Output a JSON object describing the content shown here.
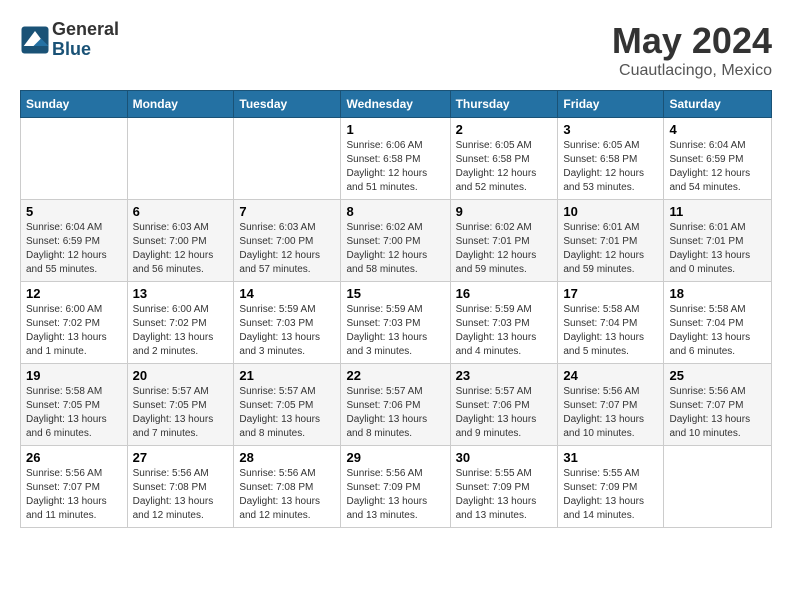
{
  "logo": {
    "general": "General",
    "blue": "Blue"
  },
  "title": "May 2024",
  "subtitle": "Cuautlacingo, Mexico",
  "days_of_week": [
    "Sunday",
    "Monday",
    "Tuesday",
    "Wednesday",
    "Thursday",
    "Friday",
    "Saturday"
  ],
  "weeks": [
    [
      {
        "day": "",
        "info": ""
      },
      {
        "day": "",
        "info": ""
      },
      {
        "day": "",
        "info": ""
      },
      {
        "day": "1",
        "info": "Sunrise: 6:06 AM\nSunset: 6:58 PM\nDaylight: 12 hours\nand 51 minutes."
      },
      {
        "day": "2",
        "info": "Sunrise: 6:05 AM\nSunset: 6:58 PM\nDaylight: 12 hours\nand 52 minutes."
      },
      {
        "day": "3",
        "info": "Sunrise: 6:05 AM\nSunset: 6:58 PM\nDaylight: 12 hours\nand 53 minutes."
      },
      {
        "day": "4",
        "info": "Sunrise: 6:04 AM\nSunset: 6:59 PM\nDaylight: 12 hours\nand 54 minutes."
      }
    ],
    [
      {
        "day": "5",
        "info": "Sunrise: 6:04 AM\nSunset: 6:59 PM\nDaylight: 12 hours\nand 55 minutes."
      },
      {
        "day": "6",
        "info": "Sunrise: 6:03 AM\nSunset: 7:00 PM\nDaylight: 12 hours\nand 56 minutes."
      },
      {
        "day": "7",
        "info": "Sunrise: 6:03 AM\nSunset: 7:00 PM\nDaylight: 12 hours\nand 57 minutes."
      },
      {
        "day": "8",
        "info": "Sunrise: 6:02 AM\nSunset: 7:00 PM\nDaylight: 12 hours\nand 58 minutes."
      },
      {
        "day": "9",
        "info": "Sunrise: 6:02 AM\nSunset: 7:01 PM\nDaylight: 12 hours\nand 59 minutes."
      },
      {
        "day": "10",
        "info": "Sunrise: 6:01 AM\nSunset: 7:01 PM\nDaylight: 12 hours\nand 59 minutes."
      },
      {
        "day": "11",
        "info": "Sunrise: 6:01 AM\nSunset: 7:01 PM\nDaylight: 13 hours\nand 0 minutes."
      }
    ],
    [
      {
        "day": "12",
        "info": "Sunrise: 6:00 AM\nSunset: 7:02 PM\nDaylight: 13 hours\nand 1 minute."
      },
      {
        "day": "13",
        "info": "Sunrise: 6:00 AM\nSunset: 7:02 PM\nDaylight: 13 hours\nand 2 minutes."
      },
      {
        "day": "14",
        "info": "Sunrise: 5:59 AM\nSunset: 7:03 PM\nDaylight: 13 hours\nand 3 minutes."
      },
      {
        "day": "15",
        "info": "Sunrise: 5:59 AM\nSunset: 7:03 PM\nDaylight: 13 hours\nand 3 minutes."
      },
      {
        "day": "16",
        "info": "Sunrise: 5:59 AM\nSunset: 7:03 PM\nDaylight: 13 hours\nand 4 minutes."
      },
      {
        "day": "17",
        "info": "Sunrise: 5:58 AM\nSunset: 7:04 PM\nDaylight: 13 hours\nand 5 minutes."
      },
      {
        "day": "18",
        "info": "Sunrise: 5:58 AM\nSunset: 7:04 PM\nDaylight: 13 hours\nand 6 minutes."
      }
    ],
    [
      {
        "day": "19",
        "info": "Sunrise: 5:58 AM\nSunset: 7:05 PM\nDaylight: 13 hours\nand 6 minutes."
      },
      {
        "day": "20",
        "info": "Sunrise: 5:57 AM\nSunset: 7:05 PM\nDaylight: 13 hours\nand 7 minutes."
      },
      {
        "day": "21",
        "info": "Sunrise: 5:57 AM\nSunset: 7:05 PM\nDaylight: 13 hours\nand 8 minutes."
      },
      {
        "day": "22",
        "info": "Sunrise: 5:57 AM\nSunset: 7:06 PM\nDaylight: 13 hours\nand 8 minutes."
      },
      {
        "day": "23",
        "info": "Sunrise: 5:57 AM\nSunset: 7:06 PM\nDaylight: 13 hours\nand 9 minutes."
      },
      {
        "day": "24",
        "info": "Sunrise: 5:56 AM\nSunset: 7:07 PM\nDaylight: 13 hours\nand 10 minutes."
      },
      {
        "day": "25",
        "info": "Sunrise: 5:56 AM\nSunset: 7:07 PM\nDaylight: 13 hours\nand 10 minutes."
      }
    ],
    [
      {
        "day": "26",
        "info": "Sunrise: 5:56 AM\nSunset: 7:07 PM\nDaylight: 13 hours\nand 11 minutes."
      },
      {
        "day": "27",
        "info": "Sunrise: 5:56 AM\nSunset: 7:08 PM\nDaylight: 13 hours\nand 12 minutes."
      },
      {
        "day": "28",
        "info": "Sunrise: 5:56 AM\nSunset: 7:08 PM\nDaylight: 13 hours\nand 12 minutes."
      },
      {
        "day": "29",
        "info": "Sunrise: 5:56 AM\nSunset: 7:09 PM\nDaylight: 13 hours\nand 13 minutes."
      },
      {
        "day": "30",
        "info": "Sunrise: 5:55 AM\nSunset: 7:09 PM\nDaylight: 13 hours\nand 13 minutes."
      },
      {
        "day": "31",
        "info": "Sunrise: 5:55 AM\nSunset: 7:09 PM\nDaylight: 13 hours\nand 14 minutes."
      },
      {
        "day": "",
        "info": ""
      }
    ]
  ]
}
